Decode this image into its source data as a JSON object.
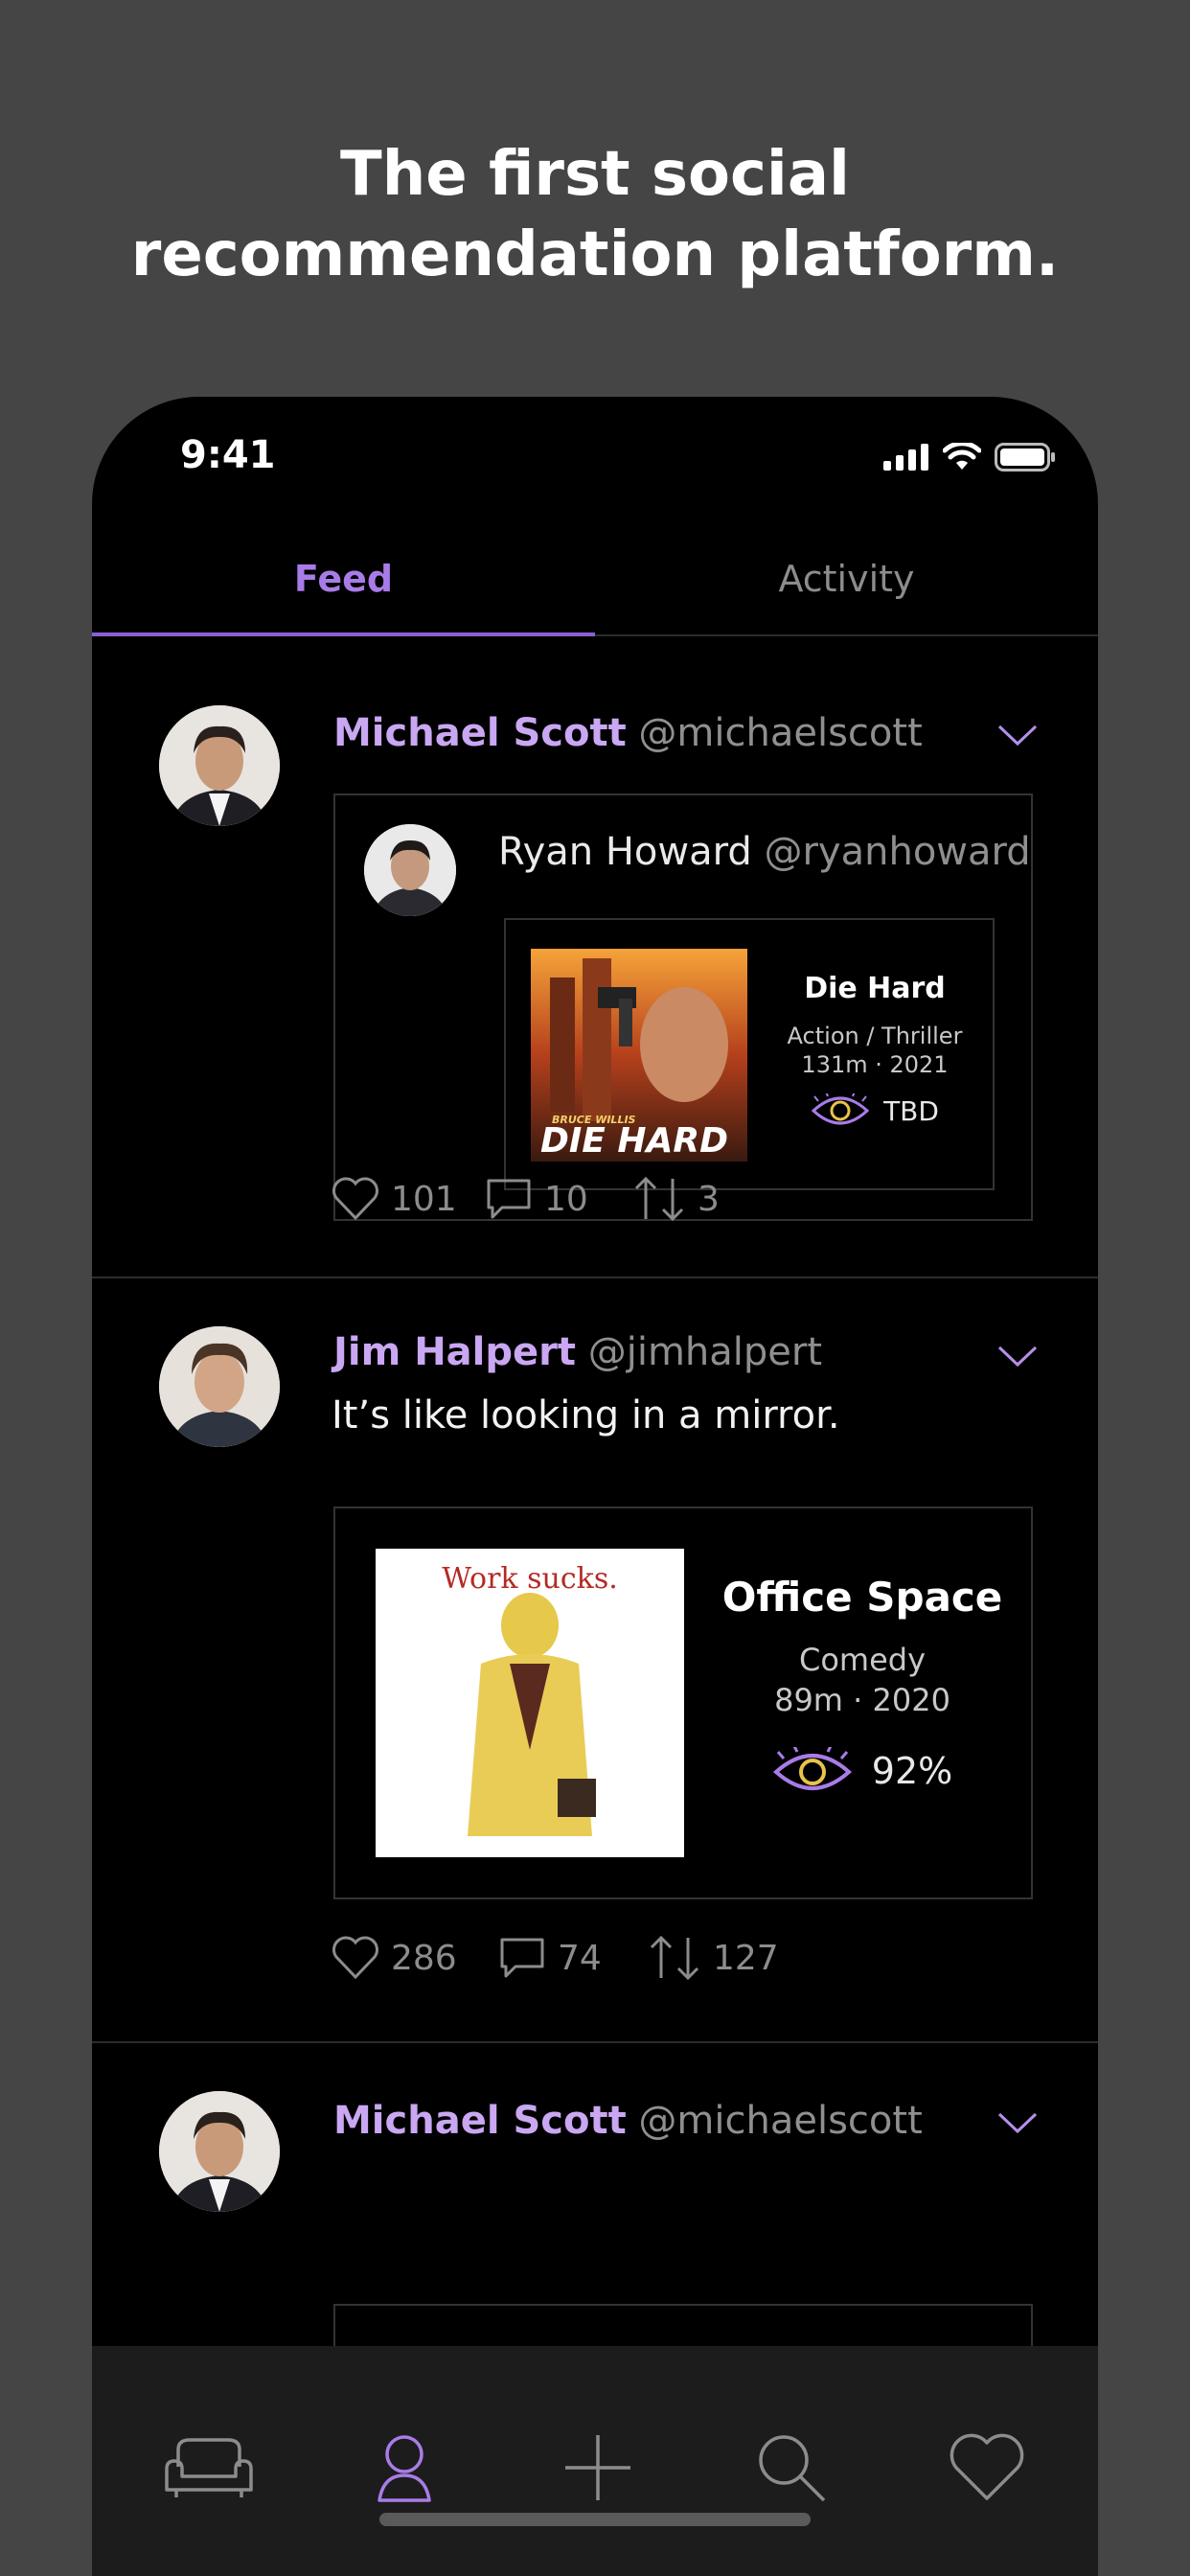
{
  "headline": {
    "line1": "The first social",
    "line2": "recommendation platform."
  },
  "status_bar": {
    "time": "9:41"
  },
  "tabs": [
    {
      "label": "Feed",
      "selected": true
    },
    {
      "label": "Activity",
      "selected": false
    }
  ],
  "posts": [
    {
      "author_name": "Michael Scott",
      "author_handle": "@michaelscott",
      "quoted": {
        "author_name": "Ryan Howard",
        "author_handle": "@ryanhoward",
        "movie": {
          "poster_credit": "BRUCE WILLIS",
          "poster_title": "DIE HARD",
          "title": "Die Hard",
          "genre": "Action / Thriller",
          "meta": "131m · 2021",
          "score": "TBD"
        }
      },
      "likes": "101",
      "comments": "10",
      "shares": "3"
    },
    {
      "author_name": "Jim Halpert",
      "author_handle": "@jimhalpert",
      "text": "It’s like looking in a mirror.",
      "movie": {
        "poster_tagline": "Work sucks.",
        "title": "Office Space",
        "genre": "Comedy",
        "meta": "89m · 2020",
        "score": "92%"
      },
      "likes": "286",
      "comments": "74",
      "shares": "127"
    },
    {
      "author_name": "Michael Scott",
      "author_handle": "@michaelscott"
    }
  ],
  "bottom_nav": [
    "couch-icon",
    "profile-icon",
    "add-icon",
    "search-icon",
    "heart-icon"
  ],
  "colors": {
    "accent": "#a87ce8",
    "author": "#c9a7f2",
    "background": "#454545",
    "phone": "#000000"
  }
}
